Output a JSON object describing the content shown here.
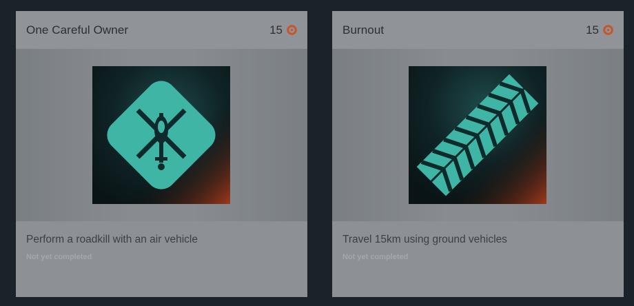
{
  "cards": [
    {
      "title": "One Careful Owner",
      "points": "15",
      "description": "Perform a roadkill with an air vehicle",
      "status": "Not yet completed",
      "badge_icon": "helicopter-badge-icon"
    },
    {
      "title": "Burnout",
      "points": "15",
      "description": "Travel 15km using ground vehicles",
      "status": "Not yet completed",
      "badge_icon": "tire-tread-badge-icon"
    }
  ],
  "colors": {
    "page_bg": "#1c222a",
    "card_bg": "#8d9196",
    "points_accent": "#c8552a",
    "badge_teal": "#3fb3a4"
  }
}
